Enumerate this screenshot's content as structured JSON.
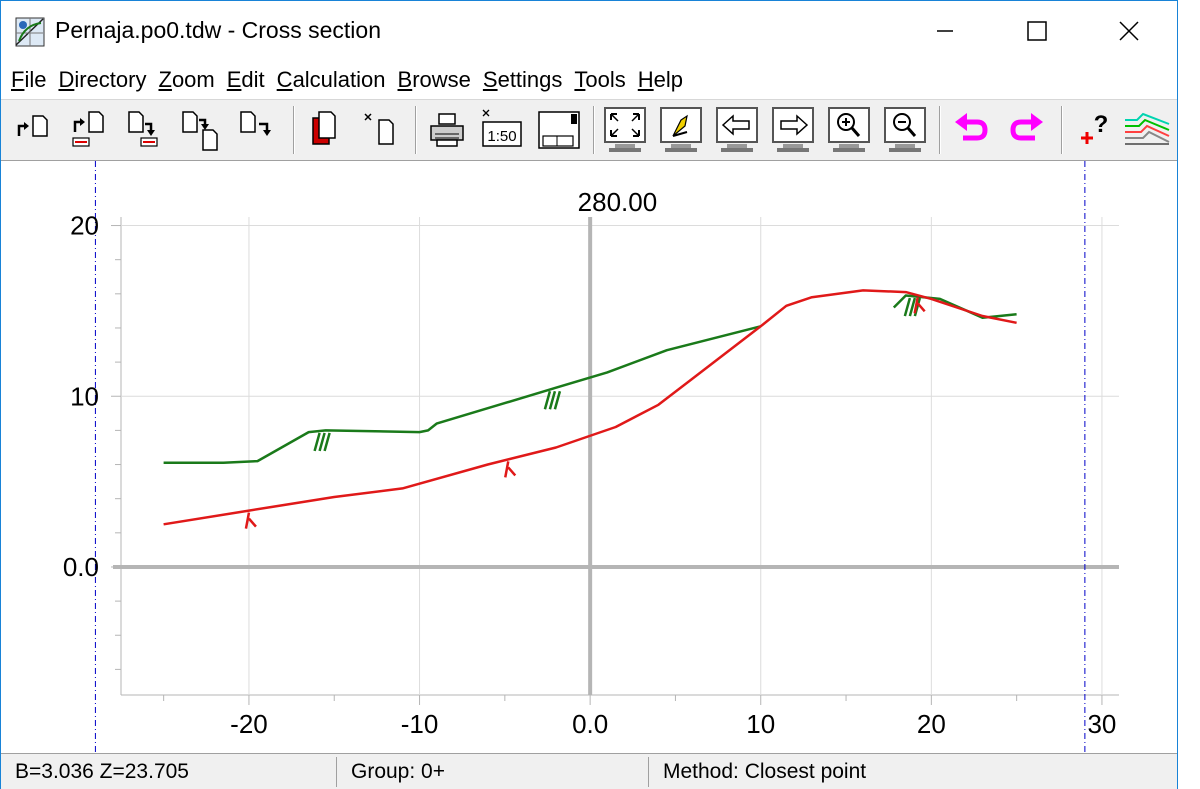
{
  "window": {
    "title": "Pernaja.po0.tdw - Cross section"
  },
  "menu": [
    {
      "accel": "F",
      "rest": "ile"
    },
    {
      "accel": "D",
      "rest": "irectory"
    },
    {
      "accel": "Z",
      "rest": "oom"
    },
    {
      "accel": "E",
      "rest": "dit"
    },
    {
      "accel": "C",
      "rest": "alculation"
    },
    {
      "accel": "B",
      "rest": "rowse"
    },
    {
      "accel": "S",
      "rest": "ettings"
    },
    {
      "accel": "T",
      "rest": "ools"
    },
    {
      "accel": "H",
      "rest": "elp"
    }
  ],
  "toolbar": {
    "scale_label": "1:50",
    "icons": [
      "open-file-icon",
      "open-file-2-icon",
      "save-file-icon",
      "save-as-icon",
      "close-file-icon",
      "copy-icon",
      "new-icon",
      "print-icon",
      "print-scale-icon",
      "layout-icon",
      "zoom-fit-icon",
      "zoom-window-icon",
      "pan-left-icon",
      "pan-right-icon",
      "zoom-in-icon",
      "zoom-out-icon",
      "undo-icon",
      "redo-icon",
      "add-question-icon",
      "profile-lines-icon"
    ]
  },
  "chart_data": {
    "type": "line",
    "title": "280.00",
    "xlim": [
      -27.5,
      31
    ],
    "ylim": [
      -7.5,
      20.5
    ],
    "x_ticks": [
      -20,
      -10,
      0,
      10,
      20,
      30
    ],
    "x_tick_labels": [
      "-20",
      "-10",
      "0.0",
      "10",
      "20",
      "30"
    ],
    "y_ticks": [
      0,
      10,
      20
    ],
    "y_tick_labels": [
      "0.0",
      "10",
      "20"
    ],
    "bounds_x": [
      -29,
      29
    ],
    "colors": {
      "terrain": "#1a7a1a",
      "rock": "#e01919",
      "axis": "#b5b5b5",
      "bound": "#0000c8"
    },
    "series": [
      {
        "key": "terrain",
        "x": [
          -25,
          -21.5,
          -19.5,
          -16.5,
          -15.5,
          -10,
          -9.5,
          -9,
          -5,
          -2,
          1,
          4.5,
          10
        ],
        "y": [
          6.1,
          6.1,
          6.2,
          7.9,
          8.0,
          7.9,
          8.0,
          8.4,
          9.6,
          10.5,
          11.4,
          12.7,
          14.1
        ],
        "symbols_x": [
          -15.8,
          -2.3
        ]
      },
      {
        "key": "terrain",
        "x": [
          17.8,
          18.5,
          20.5,
          23,
          25
        ],
        "y": [
          15.2,
          15.9,
          15.7,
          14.6,
          14.8
        ],
        "symbols_x": [
          18.8
        ]
      },
      {
        "key": "rock",
        "x": [
          -25,
          -20,
          -15,
          -11,
          -6,
          -2,
          1.5,
          4,
          7,
          10,
          11.5,
          13,
          16,
          18.5,
          20,
          23,
          25
        ],
        "y": [
          2.5,
          3.3,
          4.1,
          4.6,
          6.0,
          7.0,
          8.2,
          9.5,
          11.8,
          14.1,
          15.3,
          15.8,
          16.2,
          16.1,
          15.7,
          14.7,
          14.3
        ],
        "symbols_x": [
          -20,
          -4.8,
          19.2
        ]
      }
    ]
  },
  "status": {
    "coords": "B=3.036  Z=23.705",
    "group": "Group: 0+",
    "method": "Method: Closest point"
  }
}
